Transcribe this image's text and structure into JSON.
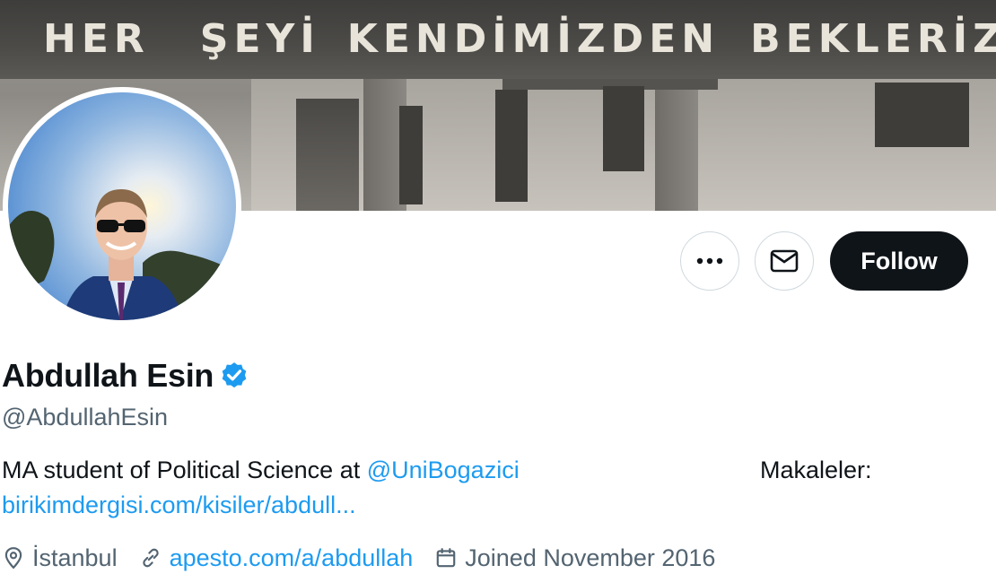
{
  "banner": {
    "sign_words": [
      "HER",
      "ŞEYİ",
      "KENDİMİZDEN",
      "BEKLERİZ"
    ]
  },
  "actions": {
    "more_icon": "ellipsis-icon",
    "message_icon": "envelope-icon",
    "follow_label": "Follow"
  },
  "profile": {
    "name": "Abdullah Esin",
    "verified_icon": "verified-badge-icon",
    "handle": "@AbdullahEsin",
    "bio_text": "MA student of Political Science at ",
    "bio_mention": "@UniBogazici",
    "bio_makaleler": "Makaleler:",
    "bio_link": "birikimdergisi.com/kisiler/abdull..."
  },
  "meta": {
    "location": "İstanbul",
    "website": "apesto.com/a/abdullah",
    "joined": "Joined November 2016"
  },
  "colors": {
    "accent": "#1d9bf0",
    "follow_bg": "#0f1419",
    "secondary_text": "#536471"
  }
}
